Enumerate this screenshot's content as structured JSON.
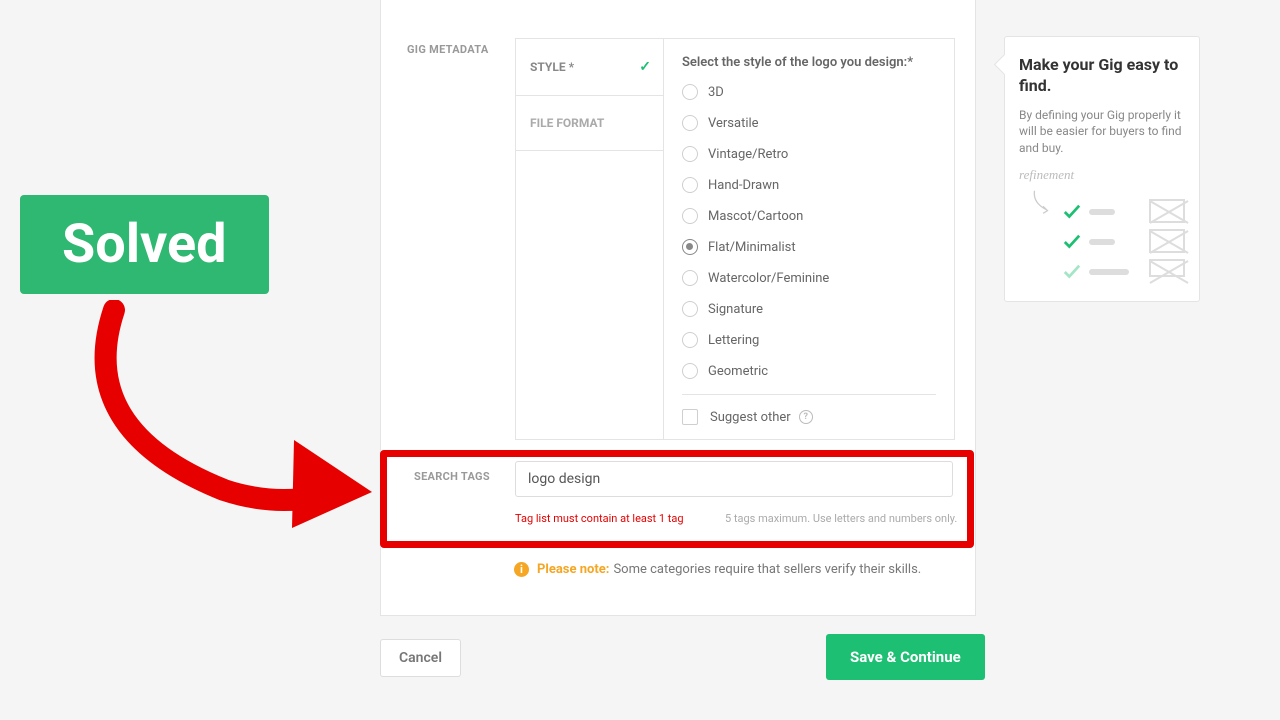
{
  "section": {
    "gig_metadata": "GIG METADATA",
    "search_tags": "SEARCH TAGS"
  },
  "meta_tabs": {
    "style": "STYLE *",
    "file_format": "FILE FORMAT"
  },
  "style": {
    "heading": "Select the style of the logo you design:*",
    "options": [
      "3D",
      "Versatile",
      "Vintage/Retro",
      "Hand-Drawn",
      "Mascot/Cartoon",
      "Flat/Minimalist",
      "Watercolor/Feminine",
      "Signature",
      "Lettering",
      "Geometric"
    ],
    "selected": "Flat/Minimalist",
    "suggest": "Suggest other"
  },
  "tags": {
    "input_value": "logo design",
    "error": "Tag list must contain at least 1 tag",
    "hint": "5 tags maximum. Use letters and numbers only."
  },
  "note": {
    "prefix": "Please note:",
    "text": " Some categories require that sellers verify their skills."
  },
  "buttons": {
    "cancel": "Cancel",
    "save": "Save & Continue"
  },
  "tip": {
    "title": "Make your Gig easy to find.",
    "text": "By defining your Gig properly it will be easier for buyers to find and buy.",
    "hand": "refinement"
  },
  "overlay": {
    "solved": "Solved"
  }
}
